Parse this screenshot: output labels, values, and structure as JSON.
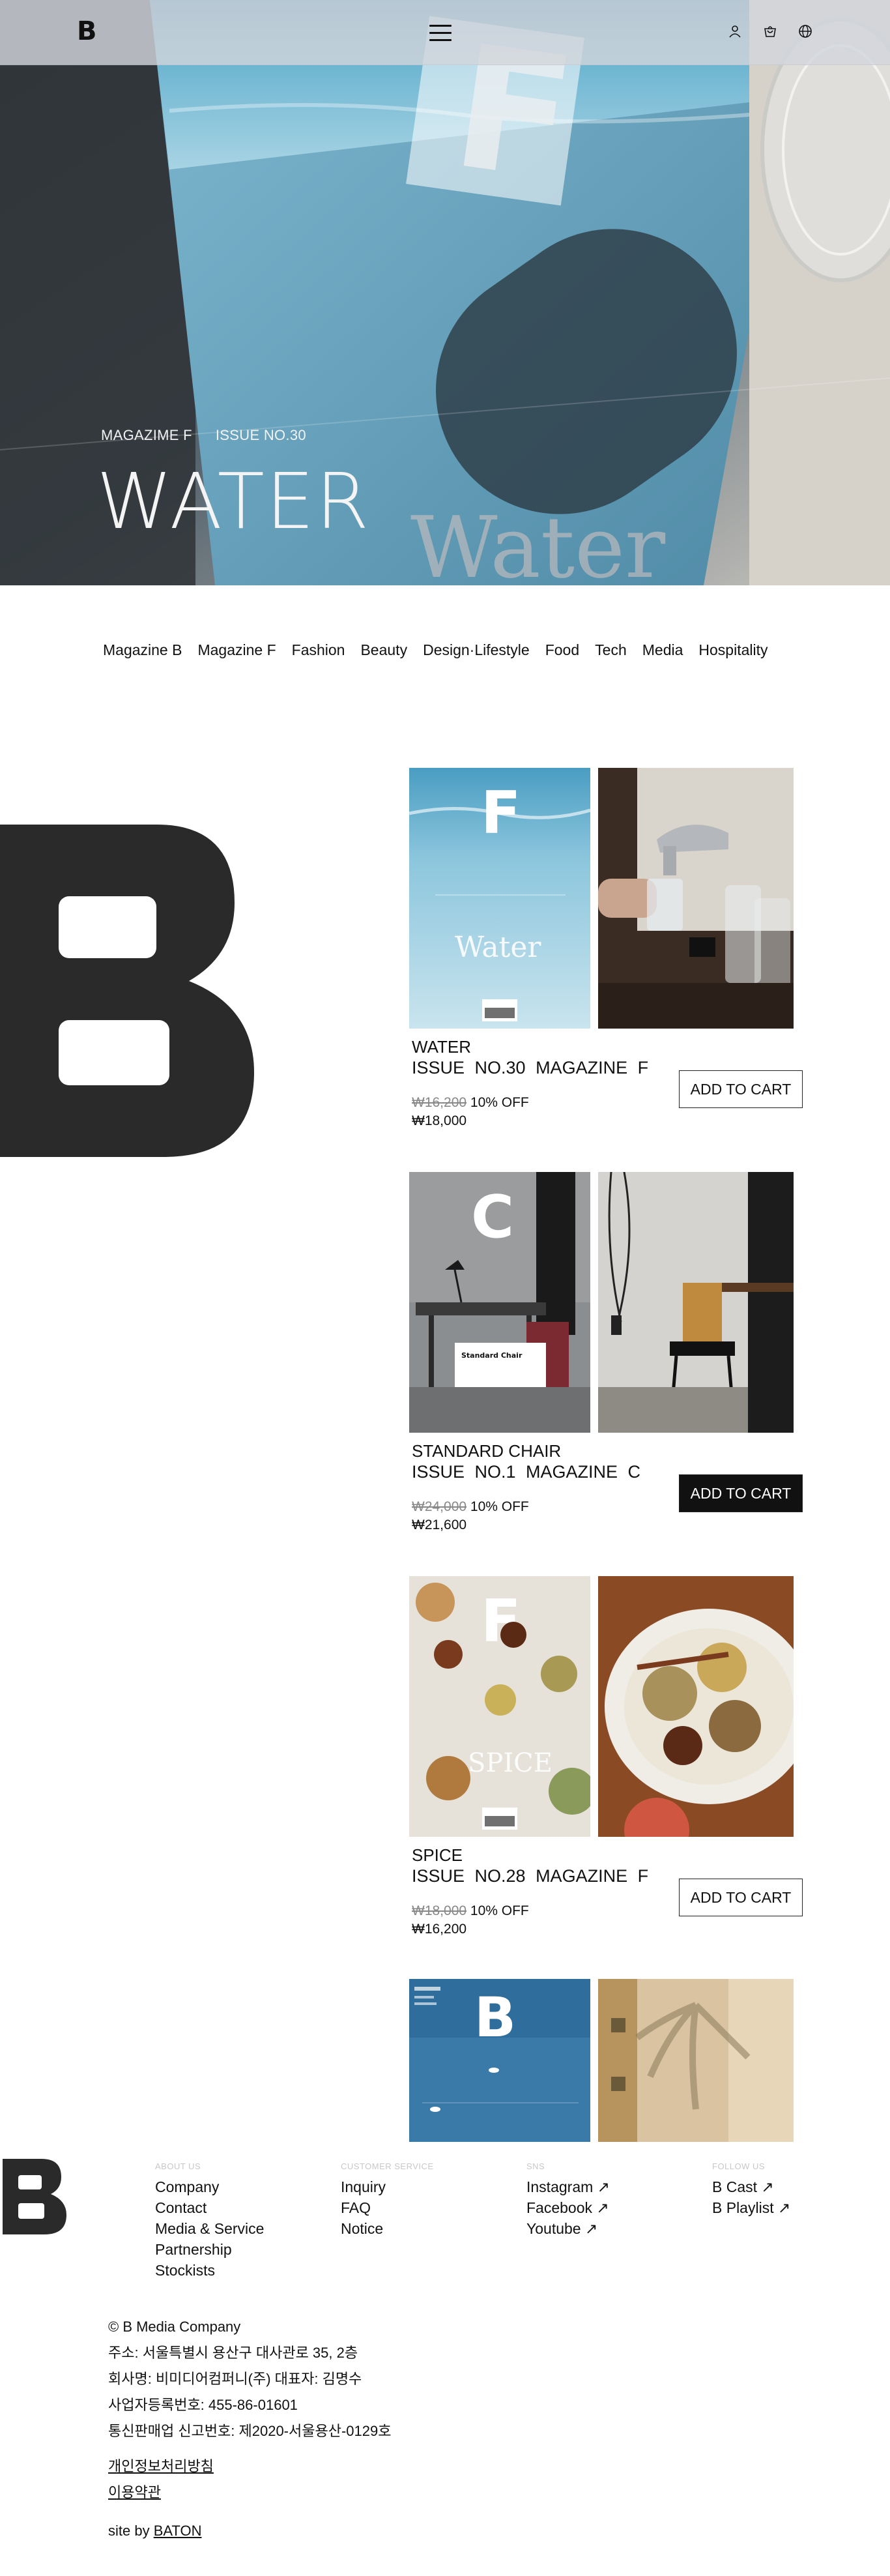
{
  "header": {
    "logo": "B",
    "menu_icon": "hamburger-menu-icon",
    "icons": [
      "user-icon",
      "cart-icon",
      "globe-icon"
    ]
  },
  "hero": {
    "magazine": "MAGAZIME F",
    "issue": "ISSUE NO.30",
    "title": "WATER",
    "cover_letter": "F",
    "cover_script": "Water"
  },
  "categories": [
    "Magazine B",
    "Magazine F",
    "Fashion",
    "Beauty",
    "Design·Lifestyle",
    "Food",
    "Tech",
    "Media",
    "Hospitality"
  ],
  "big_logo": "B",
  "products": [
    {
      "title": "WATER",
      "issue": "ISSUE NO.30 MAGAZINE F",
      "old_price": "₩16,200",
      "discount": "10% OFF",
      "price": "₩18,000",
      "cart_label": "ADD TO CART",
      "cover_letter": "F",
      "cover_script": "Water"
    },
    {
      "title": "STANDARD CHAIR",
      "issue": "ISSUE NO.1 MAGAZINE C",
      "old_price": "₩24,000",
      "discount": "10% OFF",
      "price": "₩21,600",
      "cart_label": "ADD TO CART",
      "cover_letter": "C",
      "cover_label": "Standard Chair"
    },
    {
      "title": "SPICE",
      "issue": "ISSUE NO.28 MAGAZINE F",
      "old_price": "₩18,000",
      "discount": "10% OFF",
      "price": "₩16,200",
      "cart_label": "ADD TO CART",
      "cover_letter": "F",
      "cover_script": "SPICE"
    },
    {
      "cover_letter": "B"
    }
  ],
  "footer": {
    "logo": "B",
    "columns": [
      {
        "heading": "ABOUT US",
        "links": [
          "Company",
          "Contact",
          "Media & Service",
          "Partnership",
          "Stockists"
        ]
      },
      {
        "heading": "CUSTOMER SERVICE",
        "links": [
          "Inquiry",
          "FAQ",
          "Notice"
        ]
      },
      {
        "heading": "SNS",
        "links": [
          "Instagram ↗",
          "Facebook ↗",
          "Youtube ↗"
        ]
      },
      {
        "heading": "FOLLOW US",
        "links": [
          "B Cast ↗",
          "B Playlist ↗"
        ]
      }
    ],
    "info": [
      "© B Media Company",
      " 주소: 서울특별시 용산구 대사관로 35, 2층",
      "회사명: 비미디어컴퍼니(주)  대표자: 김명수",
      "사업자등록번호: 455-86-01601",
      "통신판매업 신고번호: 제2020-서울용산-0129호"
    ],
    "policy_links": [
      "개인정보처리방침",
      "이용약관"
    ],
    "site_by_prefix": "site by ",
    "site_by": "BATON"
  }
}
